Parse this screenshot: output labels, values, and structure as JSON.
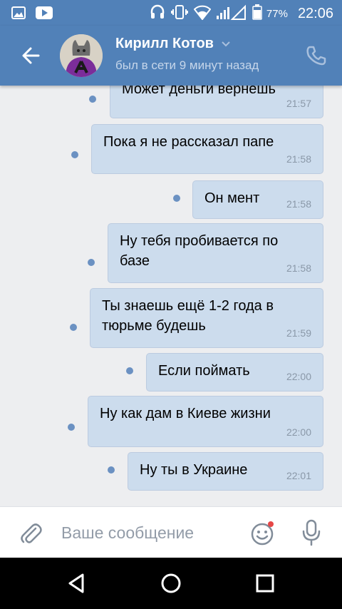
{
  "status_bar": {
    "battery": "77%",
    "time": "22:06"
  },
  "header": {
    "name": "Кирилл Котов",
    "status": "был в сети 9 минут назад"
  },
  "messages": [
    {
      "text": "Может деньги вернешь",
      "time": "21:57"
    },
    {
      "text": "Пока я не рассказал папе",
      "time": "21:58"
    },
    {
      "text": "Он мент",
      "time": "21:58"
    },
    {
      "text": "Ну тебя пробивается по базе",
      "time": "21:58"
    },
    {
      "text": "Ты знаешь ещё  1-2 года в тюрьме будешь",
      "time": "21:59"
    },
    {
      "text": "Если поймать",
      "time": "22:00"
    },
    {
      "text": "Ну как дам в Киеве жизни",
      "time": "22:00"
    },
    {
      "text": "Ну ты в Украине",
      "time": "22:01"
    }
  ],
  "composer": {
    "placeholder": "Ваше сообщение"
  },
  "colors": {
    "header": "#5181b8",
    "bubble": "#ccdced",
    "background": "#edeef0",
    "unread_dot": "#6b91c2"
  },
  "icons": {
    "status_left": [
      "gallery-icon",
      "youtube-icon"
    ],
    "status_right": [
      "headset-icon",
      "vibrate-icon",
      "wifi-icon",
      "signal-icon",
      "battery-icon"
    ],
    "header": [
      "back-arrow-icon",
      "chevron-down-icon",
      "phone-icon"
    ],
    "composer": [
      "paperclip-icon",
      "emoji-icon",
      "microphone-icon"
    ],
    "navigation": [
      "nav-back-icon",
      "nav-home-icon",
      "nav-recents-icon"
    ]
  }
}
